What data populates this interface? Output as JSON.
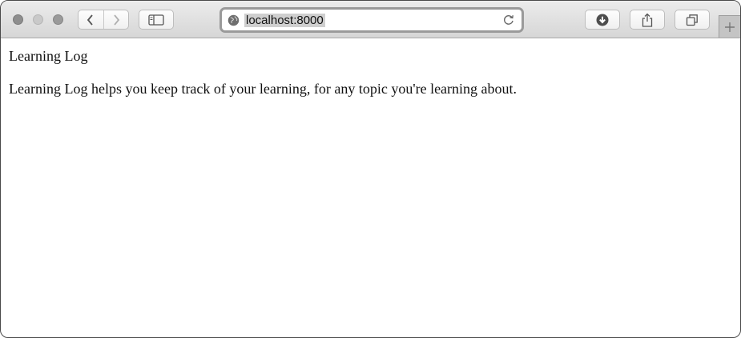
{
  "browser": {
    "address_bar": {
      "url": "localhost:8000"
    },
    "icons": {
      "close": "close-dot-icon",
      "minimize": "minimize-dot-icon",
      "zoom": "zoom-dot-icon",
      "back": "chevron-left-icon",
      "forward": "chevron-right-icon",
      "sidebar": "sidebar-icon",
      "site": "globe-icon",
      "reload": "reload-icon",
      "download": "download-icon",
      "share": "share-icon",
      "tabs": "tabs-icon",
      "new_tab": "plus-icon"
    }
  },
  "page": {
    "heading": "Learning Log",
    "intro": "Learning Log helps you keep track of your learning, for any topic you're learning about."
  }
}
